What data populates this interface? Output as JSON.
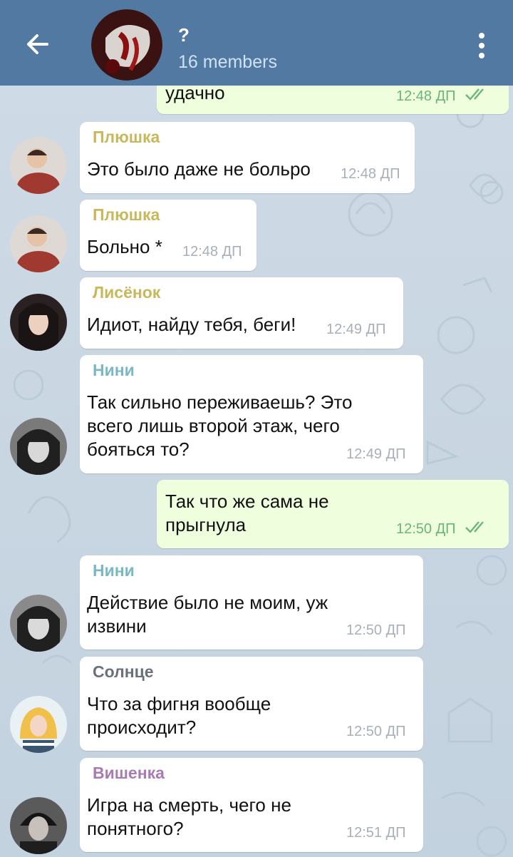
{
  "header": {
    "title": "?",
    "subtitle": "16 members"
  },
  "colors": {
    "header_bg": "#5279a2",
    "incoming_bubble": "#ffffff",
    "outgoing_bubble": "#efffde",
    "name_plyushka": "#c9b85b",
    "name_lisenok": "#c9b85b",
    "name_nini": "#7ab9c4",
    "name_solntse": "#6c6f7c",
    "name_vishenka": "#a97bb3"
  },
  "messages": [
    {
      "direction": "out",
      "text": "удачно",
      "time": "12:48 ДП",
      "read": "double-check-icon"
    },
    {
      "direction": "in",
      "sender": "Плюшка",
      "text": "Это было даже не больро",
      "time": "12:48 ДП"
    },
    {
      "direction": "in",
      "sender": "Плюшка",
      "text": "Больно *",
      "time": "12:48 ДП"
    },
    {
      "direction": "in",
      "sender": "Лисёнок",
      "text": "Идиот, найду тебя, беги!",
      "time": "12:49 ДП"
    },
    {
      "direction": "in",
      "sender": "Нини",
      "text": "Так сильно переживаешь? Это\nвсего лишь второй этаж, чего\nбояться то?",
      "time": "12:49 ДП"
    },
    {
      "direction": "out",
      "text": "Так что же сама не\nпрыгнула",
      "time": "12:50 ДП",
      "read": "double-check-icon"
    },
    {
      "direction": "in",
      "sender": "Нини",
      "text": "Действие было не моим, уж\nизвини",
      "time": "12:50 ДП"
    },
    {
      "direction": "in",
      "sender": "Солнце",
      "text": "Что за фигня вообще\nпроисходит?",
      "time": "12:50 ДП"
    },
    {
      "direction": "in",
      "sender": "Вишенка",
      "text": "Игра на смерть, чего не\nпонятного?",
      "time": "12:51 ДП"
    }
  ]
}
